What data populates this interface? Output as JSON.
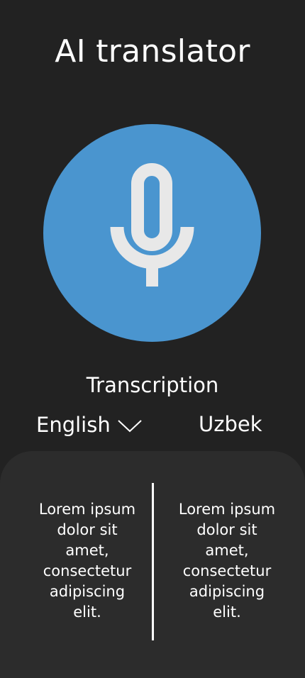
{
  "header": {
    "title": "AI translator"
  },
  "mic": {
    "icon": "microphone-icon",
    "button_color": "#4a95cf",
    "icon_color": "#e8e8e8"
  },
  "mode_label": "Transcription",
  "languages": {
    "source": "English",
    "source_dropdown_icon": "chevron-down-icon",
    "target": "Uzbek"
  },
  "panel": {
    "source_text": "Lorem ipsum dolor sit amet, consectetur adipiscing elit.",
    "translated_text": "Lorem ipsum dolor sit amet, consectetur adipiscing elit."
  },
  "colors": {
    "background": "#222222",
    "panel": "#2c2c2c",
    "text": "#ffffff"
  }
}
